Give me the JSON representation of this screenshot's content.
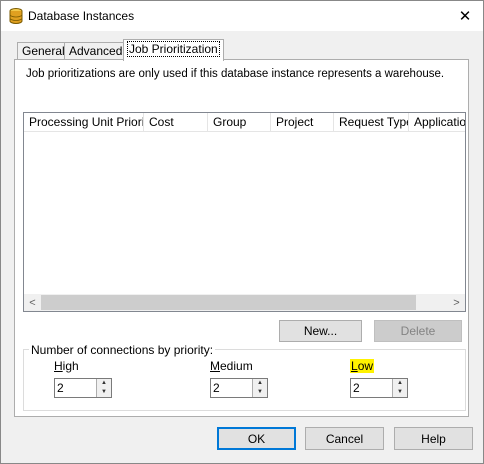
{
  "window": {
    "title": "Database Instances",
    "icon": "database-icon",
    "close_glyph": "✕"
  },
  "tabs": [
    {
      "label": "General",
      "active": false
    },
    {
      "label": "Advanced",
      "active": false
    },
    {
      "label": "Job Prioritization",
      "active": true
    }
  ],
  "info_text": "Job prioritizations are only used if this database instance represents a warehouse.",
  "table": {
    "columns": [
      "Processing Unit Priority",
      "Cost",
      "Group",
      "Project",
      "Request Type",
      "Application"
    ],
    "rows": [],
    "scroll_left_glyph": "<",
    "scroll_right_glyph": ">"
  },
  "buttons": {
    "new": "New...",
    "delete": "Delete",
    "ok": "OK",
    "cancel": "Cancel",
    "help": "Help"
  },
  "connections": {
    "group_label": "Number of connections by priority:",
    "high": {
      "label_prefix": "",
      "label_underlined": "H",
      "label_rest": "igh",
      "value": "2"
    },
    "medium": {
      "label_prefix": "",
      "label_underlined": "M",
      "label_rest": "edium",
      "value": "2"
    },
    "low": {
      "label_prefix": "",
      "label_underlined": "L",
      "label_rest": "ow",
      "value": "2",
      "highlighted": true
    }
  },
  "spinner": {
    "up_glyph": "▲",
    "down_glyph": "▼"
  },
  "colors": {
    "default_button_border": "#0078d7",
    "highlight": "#fff200"
  }
}
